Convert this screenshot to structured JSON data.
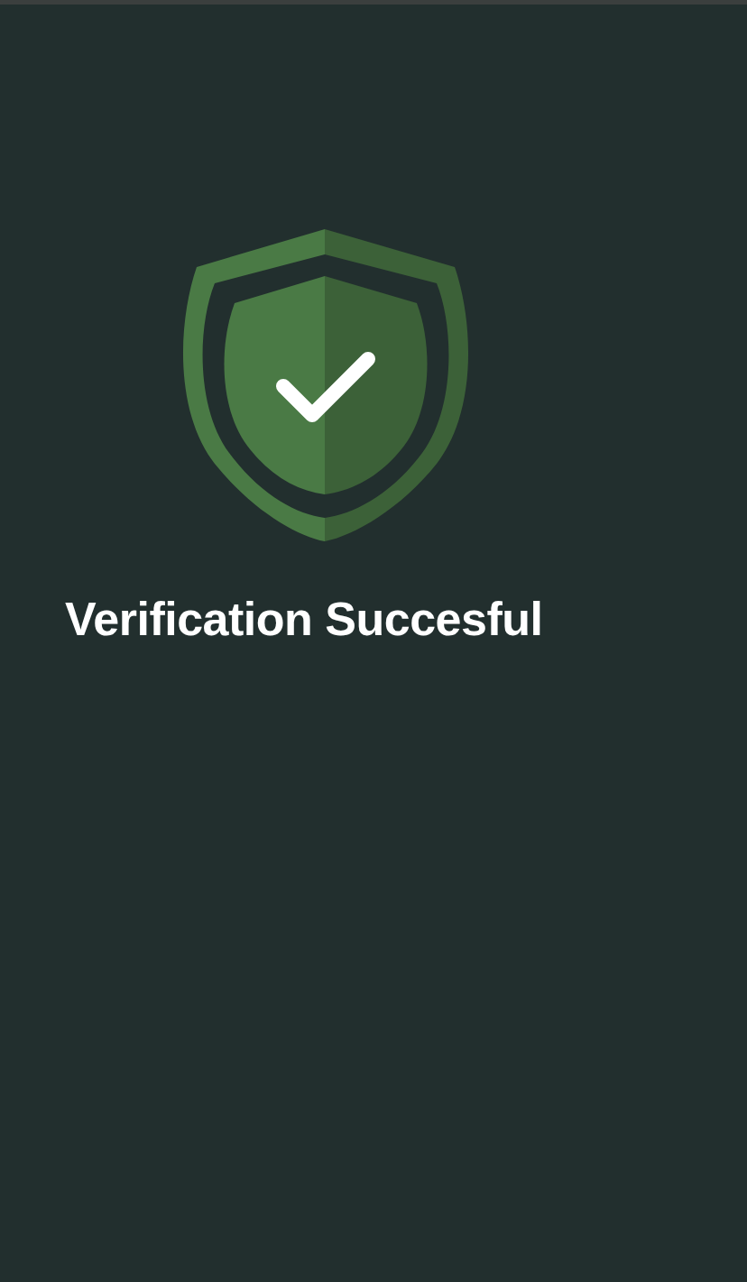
{
  "message": {
    "title": "Verification Succesful"
  }
}
